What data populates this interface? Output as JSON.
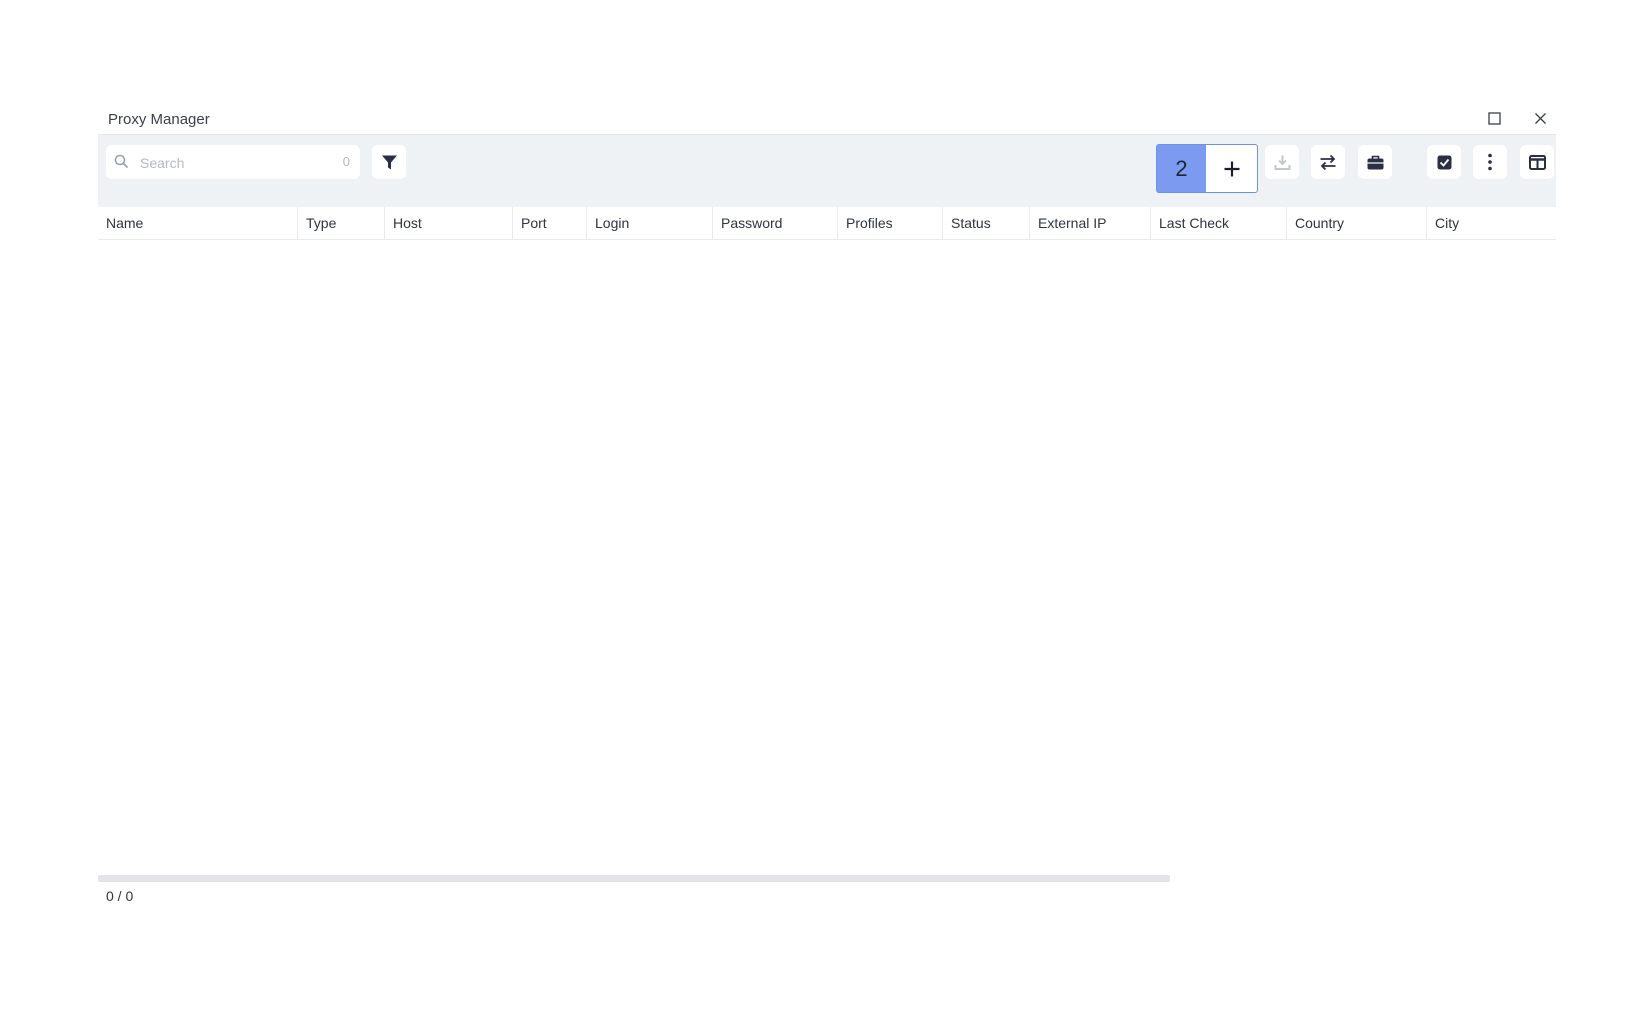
{
  "window": {
    "title": "Proxy Manager"
  },
  "toolbar": {
    "search_placeholder": "Search",
    "search_count": "0",
    "selected_badge": "2"
  },
  "table": {
    "columns": [
      "Name",
      "Type",
      "Host",
      "Port",
      "Login",
      "Password",
      "Profiles",
      "Status",
      "External IP",
      "Last Check",
      "Country",
      "City"
    ],
    "rows": []
  },
  "footer": {
    "pagination": "0 / 0"
  },
  "icons": {
    "search": "search-icon",
    "filter": "filter-icon",
    "add": "plus-icon",
    "download": "download-icon",
    "swap": "swap-icon",
    "case": "briefcase-icon",
    "check": "checkbox-icon",
    "more": "more-vertical-icon",
    "columns": "columns-icon",
    "maximize": "maximize-icon",
    "close": "close-icon"
  },
  "colors": {
    "accent": "#7b9af0",
    "toolbar_bg": "#eff2f5",
    "icon_dark": "#2a2f45"
  }
}
